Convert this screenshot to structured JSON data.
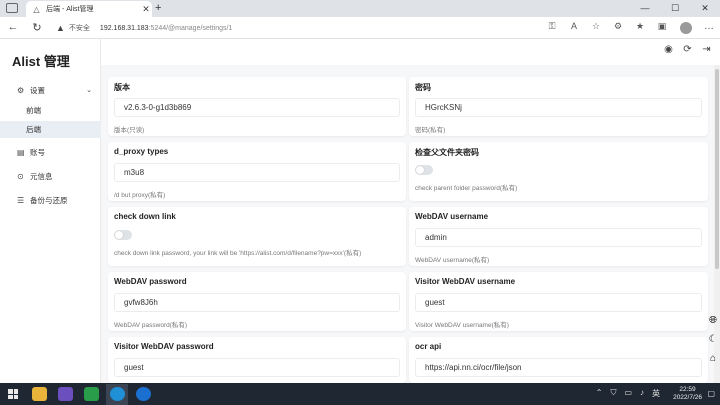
{
  "browser": {
    "tab_title": "后端 - Alist管理",
    "url_warning": "不安全",
    "url_host": "192.168.31.183",
    "url_rest": ":5244/@manage/settings/1"
  },
  "app": {
    "brand": "Alist 管理",
    "nav": {
      "settings": "设置",
      "frontend": "前端",
      "backend": "后端",
      "accounts": "账号",
      "meta": "元信息",
      "backup": "备份与还原"
    }
  },
  "settings": [
    {
      "label": "版本",
      "value": "v2.6.3-0-g1d3b869",
      "hint": "版本(只读)",
      "type": "text"
    },
    {
      "label": "密码",
      "value": "HGrcKSNj",
      "hint": "密码(私有)",
      "type": "text"
    },
    {
      "label": "d_proxy types",
      "value": "m3u8",
      "hint": "/d but proxy(私有)",
      "type": "text"
    },
    {
      "label": "检查父文件夹密码",
      "value": "",
      "hint": "check parent folder password(私有)",
      "type": "toggle"
    },
    {
      "label": "check down link",
      "value": "",
      "hint": "check down link password, your link will be 'https://alist.com/d/filename?pw=xxx'(私有)",
      "type": "toggle"
    },
    {
      "label": "WebDAV username",
      "value": "admin",
      "hint": "WebDAV username(私有)",
      "type": "text"
    },
    {
      "label": "WebDAV password",
      "value": "gvfw8J6h",
      "hint": "WebDAV password(私有)",
      "type": "text"
    },
    {
      "label": "Visitor WebDAV username",
      "value": "guest",
      "hint": "Visitor WebDAV username(私有)",
      "type": "text"
    },
    {
      "label": "Visitor WebDAV password",
      "value": "guest",
      "hint": "",
      "type": "text"
    },
    {
      "label": "ocr api",
      "value": "https://api.nn.ci/ocr/file/json",
      "hint": "",
      "type": "text"
    }
  ],
  "taskbar": {
    "time": "22:59",
    "date": "2022/7/26",
    "ime": "英"
  },
  "icons": {
    "header": [
      "github-icon",
      "refresh-icon",
      "logout-icon"
    ],
    "float": [
      "language-icon",
      "dark-mode-icon",
      "home-icon"
    ]
  }
}
